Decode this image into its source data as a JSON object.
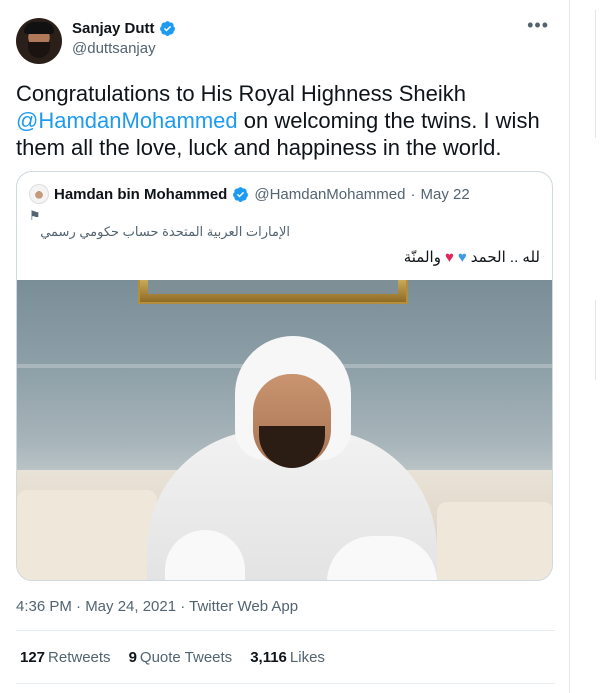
{
  "author": {
    "name": "Sanjay Dutt",
    "handle": "@duttsanjay"
  },
  "tweet": {
    "text_before": "Congratulations to His Royal Highness Sheikh ",
    "mention": "@HamdanMohammed",
    "text_after": " on welcoming the twins. I wish them all the love, luck and happiness in the world."
  },
  "quoted": {
    "name": "Hamdan bin Mohammed",
    "handle": "@HamdanMohammed",
    "separator": "·",
    "date": "May 22",
    "flag_icon": "⚑",
    "bio": "الإمارات العربية المتحدة حساب حكومي رسمي",
    "body_part1": "لله .. الحمد",
    "body_part2": "والمنّة",
    "heart_blue": "♥",
    "heart_red": "♥"
  },
  "meta": {
    "timestamp": "4:36 PM · May 24, 2021 · Twitter Web App"
  },
  "stats": {
    "retweets_count": "127",
    "retweets_label": "Retweets",
    "quotes_count": "9",
    "quotes_label": "Quote Tweets",
    "likes_count": "3,116",
    "likes_label": "Likes"
  },
  "icons": {
    "more": "•••"
  },
  "colors": {
    "accent": "#1d9bf0",
    "secondary_text": "#536471",
    "border": "#cfd9de"
  }
}
